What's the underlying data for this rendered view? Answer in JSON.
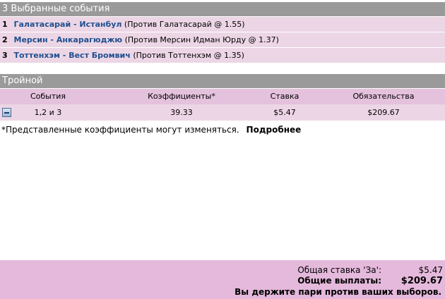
{
  "selections_header": "3 Выбранные события",
  "selections": [
    {
      "num": "1",
      "match": "Галатасарай - Истанбул",
      "detail": "(Против  Галатасарай @ 1.55)"
    },
    {
      "num": "2",
      "match": "Мерсин - Анкарагюджю",
      "detail": "(Против  Мерсин Идман Юрду @ 1.37)"
    },
    {
      "num": "3",
      "match": "Тоттенхэм - Вест Бромвич",
      "detail": "(Против  Тоттенхэм @ 1.35)"
    }
  ],
  "bet_header": "Тройной",
  "columns": {
    "events": "События",
    "odds": "Коэффициенты*",
    "stake": "Ставка",
    "liability": "Обязательства"
  },
  "row": {
    "events": "1,2 и 3",
    "odds": "39.33",
    "stake": "$5.47",
    "liability": "$209.67"
  },
  "note": {
    "text": "*Представленные коэффициенты могут изменяться.",
    "more_link": "Подробнее"
  },
  "footer": {
    "stake_label": "Общая ставка 'За':",
    "stake_value": "$5.47",
    "payout_label": "Общие выплаты:",
    "payout_value": "$209.67",
    "notice": "Вы держите пари против ваших выборов."
  },
  "colors": {
    "header_bg": "#9a9a9a",
    "row_bg": "#ecd6e6",
    "footer_bg": "#e4b9db",
    "link_color": "#1f4f8f"
  }
}
